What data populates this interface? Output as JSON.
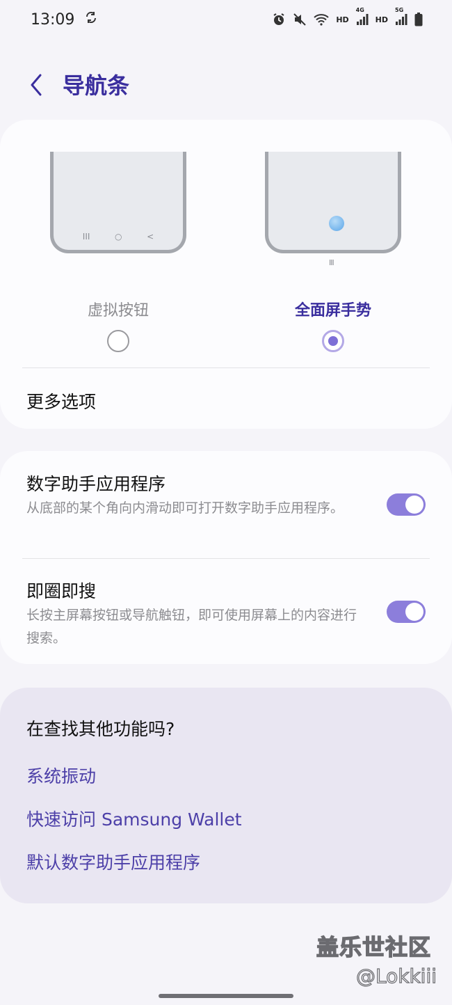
{
  "status_bar": {
    "time": "13:09",
    "sync_icon": "sync-icon",
    "hd1": "HD",
    "net1": "4G",
    "hd2": "HD",
    "net2": "5G"
  },
  "header": {
    "back_icon": "chevron-left-icon",
    "title": "导航条"
  },
  "nav_type": {
    "options": [
      {
        "label": "虚拟按钮",
        "selected": false
      },
      {
        "label": "全面屏手势",
        "selected": true
      }
    ],
    "nav_keys": [
      "III",
      "○",
      "<"
    ],
    "gesture_hint": "III",
    "more_options": "更多选项"
  },
  "settings": {
    "digital_assistant": {
      "title": "数字助手应用程序",
      "desc": "从底部的某个角向内滑动即可打开数字助手应用程序。",
      "enabled": true
    },
    "circle_to_search": {
      "title": "即圈即搜",
      "desc": "长按主屏幕按钮或导航触钮，即可使用屏幕上的内容进行搜索。",
      "enabled": true
    }
  },
  "looking_for": {
    "title": "在查找其他功能吗?",
    "links": [
      "系统振动",
      "快速访问 Samsung Wallet",
      "默认数字助手应用程序"
    ]
  },
  "watermark": {
    "line1": "盖乐世社区",
    "line2": "@Lokkiii"
  },
  "colors": {
    "accent": "#3a2e9e",
    "link": "#4c3fa8",
    "toggle_on": "#8c7edb",
    "background": "#f5f4f9"
  }
}
